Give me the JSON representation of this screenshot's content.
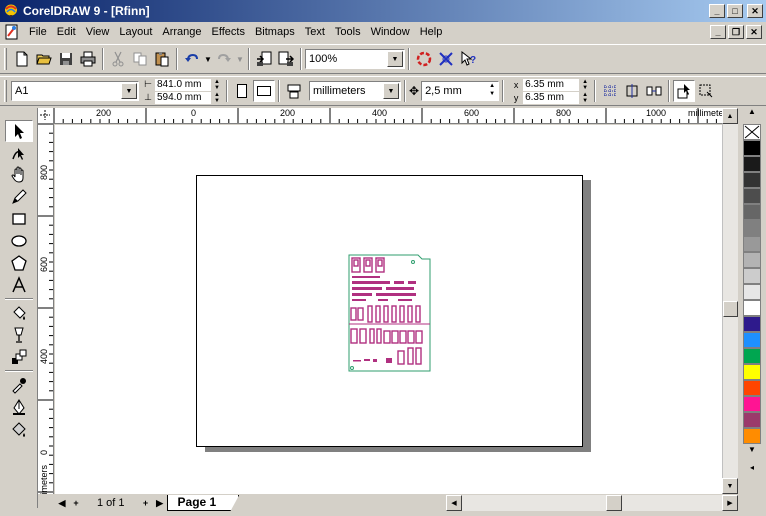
{
  "window": {
    "title": "CorelDRAW 9 - [Rfinn]",
    "min_glyph": "_",
    "max_glyph": "□",
    "restore_glyph": "❐",
    "close_glyph": "✕"
  },
  "menu": {
    "items": [
      "File",
      "Edit",
      "View",
      "Layout",
      "Arrange",
      "Effects",
      "Bitmaps",
      "Text",
      "Tools",
      "Window",
      "Help"
    ]
  },
  "standard_toolbar": {
    "zoom_value": "100%"
  },
  "property_bar": {
    "paper_type": "A1",
    "paper_width": "841.0 mm",
    "paper_height": "594.0 mm",
    "units": "millimeters",
    "nudge": "2,5 mm",
    "duplicate_x": "6.35 mm",
    "duplicate_y": "6.35 mm"
  },
  "ruler": {
    "h_labels": [
      "200",
      "0",
      "200",
      "400",
      "600",
      "800",
      "1000",
      "millimeters"
    ],
    "v_labels": [
      "800",
      "600",
      "400",
      "200",
      "0"
    ],
    "v_units": "millimeters"
  },
  "navigator": {
    "page_count": "1 of 1",
    "first_glyph": "◀",
    "prev_glyph": "◂",
    "next_glyph": "▸",
    "last_glyph": "▶",
    "add_glyph": "+",
    "page_tab": "Page 1"
  },
  "palette": {
    "colors": [
      "#000000",
      "#1a1a1a",
      "#333333",
      "#4d4d4d",
      "#666666",
      "#808080",
      "#999999",
      "#b3b3b3",
      "#cccccc",
      "#e6e6e6",
      "#ffffff",
      "#2e1a8c",
      "#1e90ff",
      "#00a650",
      "#ffff00",
      "#ff4500",
      "#ff1493",
      "#9b3a6b",
      "#ff8c00"
    ]
  },
  "colors": {
    "drawing_magenta": "#b03080",
    "drawing_border": "#2f9e6e"
  }
}
